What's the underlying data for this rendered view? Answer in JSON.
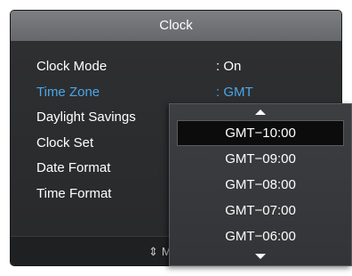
{
  "window": {
    "title": "Clock"
  },
  "menu": {
    "items": [
      {
        "label": "Clock Mode",
        "value": ": On",
        "active": false
      },
      {
        "label": "Time Zone",
        "value": ": GMT",
        "active": true
      },
      {
        "label": "Daylight Savings",
        "value": "",
        "active": false
      },
      {
        "label": "Clock Set",
        "value": "",
        "active": false
      },
      {
        "label": "Date Format",
        "value": "",
        "active": false
      },
      {
        "label": "Time Format",
        "value": "",
        "active": false
      }
    ]
  },
  "dropdown": {
    "up_icon": "triangle-up-icon",
    "down_icon": "triangle-down-icon",
    "selected_value": "GMT−10:00",
    "options": [
      "GMT−10:00",
      "GMT−09:00",
      "GMT−08:00",
      "GMT−07:00",
      "GMT−06:00"
    ]
  },
  "footer": {
    "hint_icon": "up-down-arrows-icon",
    "hint_text": "M"
  },
  "colors": {
    "accent": "#4aa7ea",
    "title_bar": "#6f7174",
    "panel_bg": "#2c2d2f",
    "text": "#ffffff"
  }
}
